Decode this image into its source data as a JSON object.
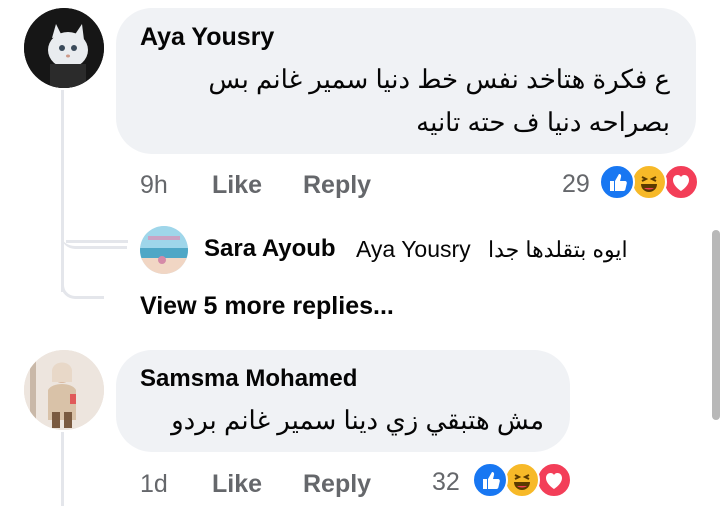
{
  "comments": [
    {
      "author": "Aya Yousry",
      "text_line1": "ع فكرة هتاخد نفس خط دنيا سمير غانم بس",
      "text_line2": "بصراحه دنيا ف حته تانيه",
      "time": "9h",
      "like": "Like",
      "reply": "Reply",
      "reaction_count": "29",
      "reactions": [
        "like-icon",
        "haha-icon",
        "love-icon"
      ]
    },
    {
      "author": "Samsma Mohamed",
      "text_line1": "مش هتبقي زي دينا سمير غانم بردو",
      "time": "1d",
      "like": "Like",
      "reply": "Reply",
      "reaction_count": "32",
      "reactions": [
        "like-icon",
        "haha-icon",
        "love-icon"
      ]
    }
  ],
  "reply": {
    "author": "Sara Ayoub",
    "mention": "Aya Yousry",
    "text": "ايوه بتقلدها جدا"
  },
  "view_more": "View 5 more replies...",
  "colors": {
    "bubble": "#f0f2f5",
    "meta": "#65676b",
    "like_blue": "#1877f2",
    "haha_yellow": "#f7b928",
    "love_red": "#f33e58",
    "thread_line": "#e4e6eb"
  }
}
